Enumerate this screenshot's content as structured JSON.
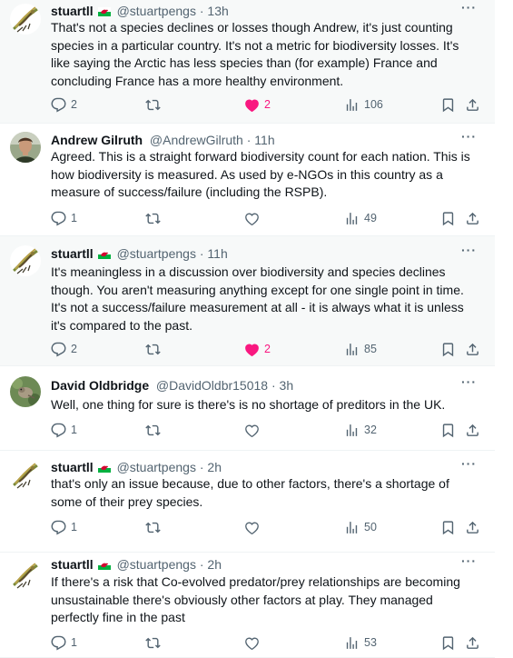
{
  "posts": [
    {
      "id": "p1",
      "author": "stuartll",
      "flag": true,
      "handle": "@stuartpengs",
      "time": "13h",
      "avatar": "fly-lure",
      "text": "That's not a species declines or losses though Andrew, it's just counting species in a particular country. It's not a metric for biodiversity losses. It's like saying the Arctic has less species than (for example) France and concluding France has a more healthy environment.",
      "replies": "2",
      "reposts": "",
      "likes": "2",
      "liked": true,
      "views": "106"
    },
    {
      "id": "p2",
      "author": "Andrew Gilruth",
      "flag": false,
      "handle": "@AndrewGilruth",
      "time": "11h",
      "avatar": "man-portrait",
      "text": "Agreed. This is a straight forward biodiversity count for each nation. This is how biodiversity is measured. As used by e-NGOs in this country as a measure of success/failure (including the RSPB).",
      "replies": "1",
      "reposts": "",
      "likes": "",
      "liked": false,
      "views": "49"
    },
    {
      "id": "p3",
      "author": "stuartll",
      "flag": true,
      "handle": "@stuartpengs",
      "time": "11h",
      "avatar": "fly-lure",
      "text": "It's meaningless in a discussion over biodiversity and species declines though. You aren't measuring anything except for one single point in time. It's not a success/failure measurement at all - it is always what it is unless it's compared to the past.",
      "replies": "2",
      "reposts": "",
      "likes": "2",
      "liked": true,
      "views": "85"
    },
    {
      "id": "p4",
      "author": "David Oldbridge",
      "flag": false,
      "handle": "@DavidOldbr15018",
      "time": "3h",
      "avatar": "bird-nature",
      "text": "Well, one thing for sure is there's is no shortage of preditors in the UK.",
      "replies": "1",
      "reposts": "",
      "likes": "",
      "liked": false,
      "views": "32"
    },
    {
      "id": "p5",
      "author": "stuartll",
      "flag": true,
      "handle": "@stuartpengs",
      "time": "2h",
      "avatar": "fly-lure",
      "text": "that's only an issue because, due to other factors, there's a shortage of some of their prey species.",
      "replies": "1",
      "reposts": "",
      "likes": "",
      "liked": false,
      "views": "50"
    },
    {
      "id": "p6",
      "author": "stuartll",
      "flag": true,
      "handle": "@stuartpengs",
      "time": "2h",
      "avatar": "fly-lure",
      "text": "If there's a risk that Co-evolved predator/prey relationships are becoming unsustainable there's obviously other factors at play. They managed perfectly fine in the past",
      "replies": "1",
      "reposts": "",
      "likes": "",
      "liked": false,
      "views": "53"
    }
  ],
  "labels": {
    "dot": "·",
    "more": "···"
  },
  "colors": {
    "like_active": "#f91880",
    "muted": "#536471",
    "text": "#0f1419",
    "shaded_bg": "#f7f9f9"
  }
}
